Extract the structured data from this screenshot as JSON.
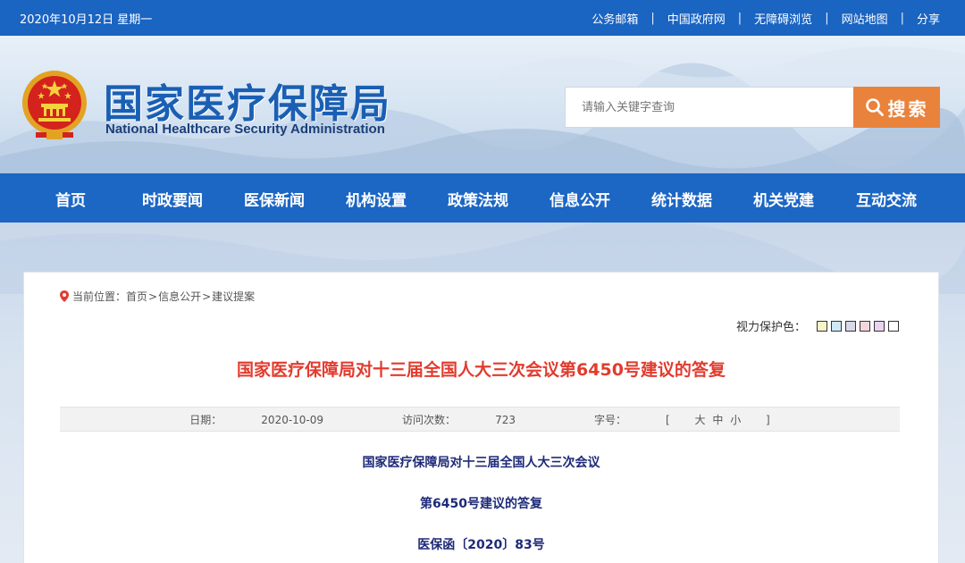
{
  "topbar": {
    "date": "2020年10月12日 星期一",
    "links": [
      "公务邮箱",
      "中国政府网",
      "无障碍浏览",
      "网站地图",
      "分享"
    ],
    "separator": "|"
  },
  "header": {
    "title": "国家医疗保障局",
    "subtitle": "National Healthcare Security Administration",
    "search_placeholder": "请输入关键字查询",
    "search_button": "搜索"
  },
  "nav": {
    "items": [
      "首页",
      "时政要闻",
      "医保新闻",
      "机构设置",
      "政策法规",
      "信息公开",
      "统计数据",
      "机关党建",
      "互动交流"
    ]
  },
  "breadcrumb": {
    "prefix": "当前位置：",
    "items": [
      "首页",
      "信息公开",
      "建议提案"
    ],
    "separator": ">"
  },
  "eye_protection": {
    "label": "视力保护色：",
    "colors": [
      "#f9f3c8",
      "#cfe8f6",
      "#d8d8e8",
      "#f3d6dc",
      "#e8d4f0",
      "#ffffff"
    ]
  },
  "article": {
    "title": "国家医疗保障局对十三届全国人大三次会议第6450号建议的答复",
    "date_label": "日期：",
    "date": "2020-10-09",
    "visits_label": "访问次数：",
    "visits": "723",
    "fontsize_label": "字号：",
    "fontsize_open": "[",
    "fontsize_options": [
      "大",
      "中",
      "小"
    ],
    "fontsize_close": "]",
    "lines": [
      "国家医疗保障局对十三届全国人大三次会议",
      "第6450号建议的答复",
      "医保函〔2020〕83号"
    ]
  },
  "colors": {
    "primary_blue": "#1a64c2",
    "title_red": "#e23b2e",
    "search_orange": "#e9833c",
    "body_navy": "#1e2a78"
  }
}
